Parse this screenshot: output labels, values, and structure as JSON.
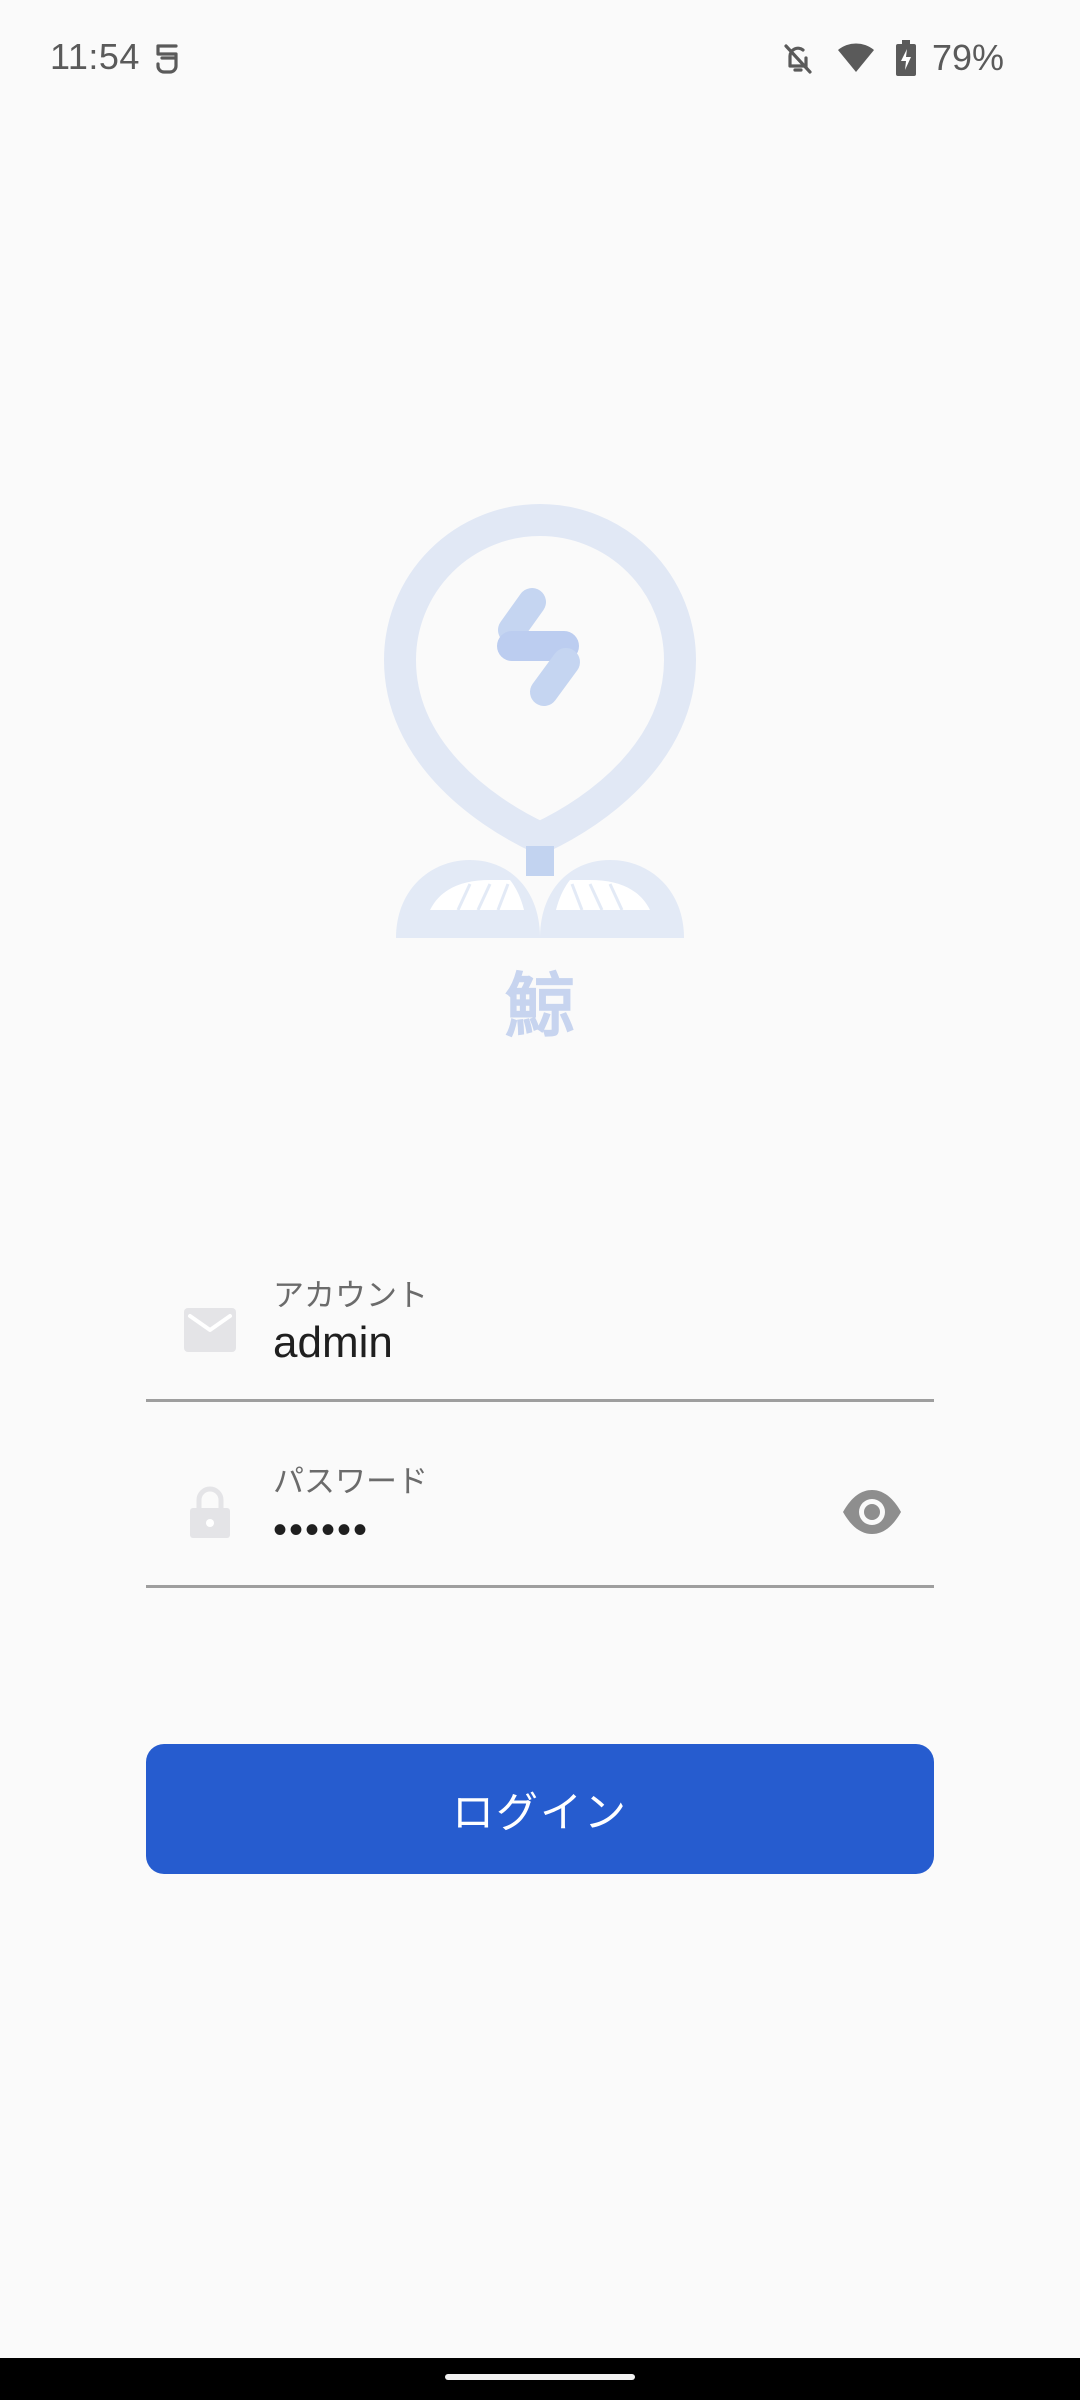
{
  "status_bar": {
    "time": "11:54",
    "left_icon": "assistant-notification-icon",
    "icons": [
      "notifications-off-icon",
      "wifi-icon",
      "battery-charging-icon"
    ],
    "battery": "79%"
  },
  "logo": {
    "character": "鯨",
    "color": "#c7d4ef"
  },
  "form": {
    "account": {
      "label": "アカウント",
      "value": "admin",
      "icon": "mail-icon"
    },
    "password": {
      "label": "パスワード",
      "value": "••••••",
      "icon": "lock-icon",
      "toggle_icon": "eye-icon"
    }
  },
  "login_button": {
    "label": "ログイン",
    "color": "#265ccf"
  }
}
